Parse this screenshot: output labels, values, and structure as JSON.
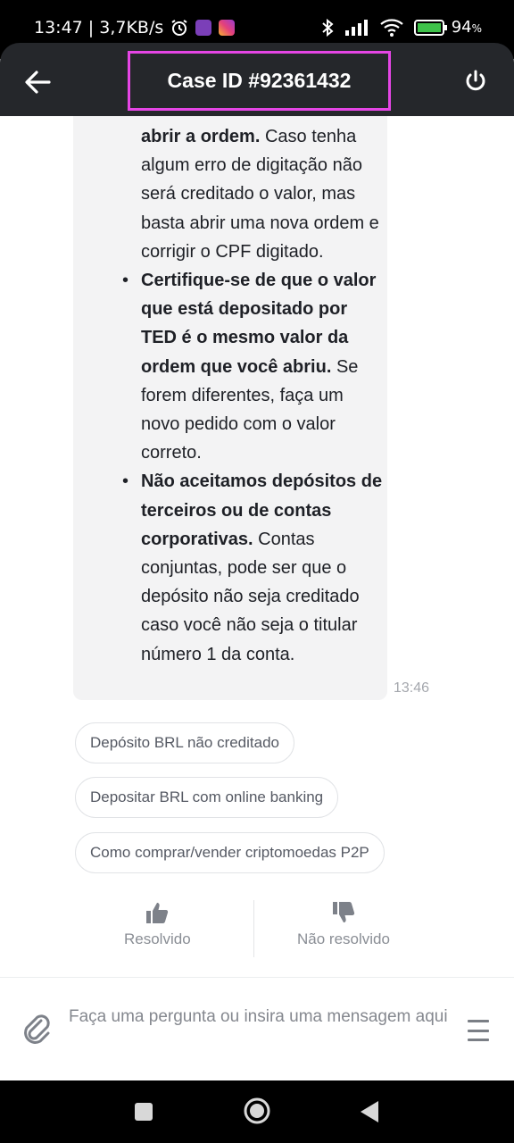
{
  "status_bar": {
    "time_speed": "13:47 | 3,7KB/s",
    "battery": "94"
  },
  "header": {
    "title": "Case ID #92361432",
    "back_icon": "arrow-left-icon",
    "power_icon": "power-icon"
  },
  "message": {
    "intro_bold": "abrir a ordem.",
    "intro_text": " Caso tenha algum erro de digitação não será creditado o valor, mas basta abrir uma nova ordem e corrigir o CPF digitado.",
    "bullets": [
      {
        "bold": "Certifique-se de que o valor que está depositado por TED é o mesmo valor da ordem que você abriu.",
        "text": " Se forem diferentes, faça um novo pedido com o valor correto."
      },
      {
        "bold": "Não aceitamos depósitos de terceiros ou de contas corporativas.",
        "text": " Contas conjuntas, pode ser que o depósito não seja creditado caso você não seja o titular número 1 da conta."
      }
    ],
    "timestamp": "13:46"
  },
  "suggestions": [
    "Depósito BRL não creditado",
    "Depositar BRL com online banking",
    "Como comprar/vender criptomoedas P2P"
  ],
  "feedback": {
    "resolved": "Resolvido",
    "not_resolved": "Não resolvido"
  },
  "input": {
    "placeholder": "Faça uma pergunta ou insira uma mensagem aqui"
  },
  "colors": {
    "header_bg": "#25272b",
    "highlight_border": "#e545e5",
    "bubble_bg": "#f3f3f4"
  }
}
